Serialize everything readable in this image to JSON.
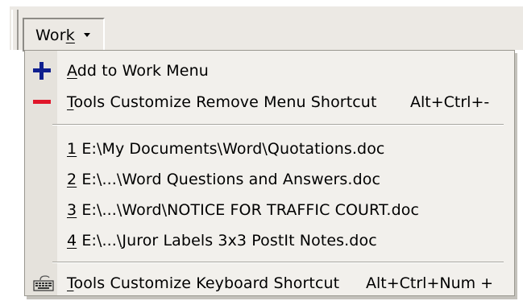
{
  "menu": {
    "title": "Work",
    "title_mnemonic": "k",
    "items": [
      {
        "icon": "plus-icon",
        "label": "Add to Work Menu",
        "mnemonic": "A",
        "shortcut": "",
        "color": "#0f1f8f"
      },
      {
        "icon": "minus-icon",
        "label": "Tools Customize Remove Menu Shortcut",
        "mnemonic": "T",
        "shortcut": "Alt+Ctrl+-",
        "color": "#e0162a"
      }
    ],
    "recent_files": [
      {
        "number": "1",
        "path": "E:\\My Documents\\Word\\Quotations.doc"
      },
      {
        "number": "2",
        "path": "E:\\...\\Word Questions and Answers.doc"
      },
      {
        "number": "3",
        "path": "E:\\...\\Word\\NOTICE FOR TRAFFIC COURT.doc"
      },
      {
        "number": "4",
        "path": "E:\\...\\Juror Labels 3x3 PostIt Notes.doc"
      }
    ],
    "keyboard_item": {
      "icon": "keyboard-icon",
      "label": "Tools Customize Keyboard Shortcut",
      "mnemonic": "T",
      "shortcut": "Alt+Ctrl+Num +"
    }
  }
}
